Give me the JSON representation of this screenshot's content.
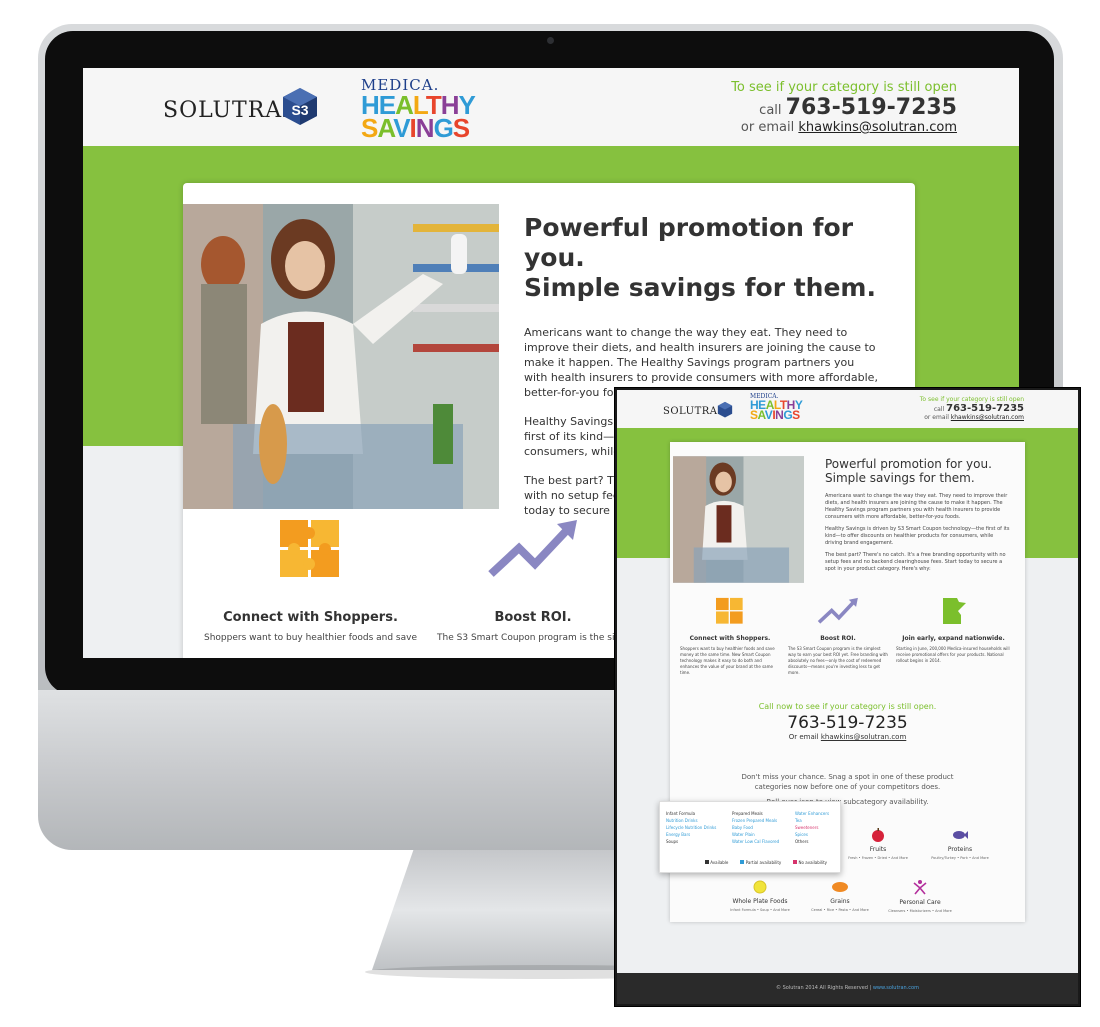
{
  "brand": {
    "solutran": "SOLUTRAN",
    "medica": "MEDICA.",
    "healthy_letters": [
      "H",
      "E",
      "A",
      "L",
      "T",
      "H",
      "Y"
    ],
    "savings_letters": [
      "S",
      "A",
      "V",
      "I",
      "N",
      "G",
      "S"
    ],
    "healthy_colors": [
      "#2f9bd6",
      "#2f9bd6",
      "#7bbf2c",
      "#f3a814",
      "#e8452c",
      "#8a3f97",
      "#2f9bd6"
    ],
    "savings_colors": [
      "#f3a814",
      "#7bbf2c",
      "#2f9bd6",
      "#e8452c",
      "#8a3f97",
      "#2f9bd6",
      "#e8452c"
    ]
  },
  "header": {
    "tagline": "To see if your category is still open",
    "call_prefix": "call",
    "phone": "763-519-7235",
    "email_prefix": "or email",
    "email": "khawkins@solutran.com"
  },
  "hero": {
    "title_line1": "Powerful promotion for you.",
    "title_line2": "Simple savings for them.",
    "para1": "Americans want to change the way they eat. They need to improve their diets, and health insurers are joining the cause to make it happen. The Healthy Savings program partners you with health insurers to provide consumers with more affordable, better-for-you foods.",
    "para2_desktop": "Healthy Savings is driven by S3 Smart Coupon technology—the first of its kind—",
    "para2_desktop_b": "consumers, while",
    "para3_desktop": "The best part? Th",
    "para3_desktop_b": "with no setup fee",
    "para3_desktop_c": "today to secure a",
    "para2": "Healthy Savings is driven by S3 Smart Coupon technology—the first of its kind—to offer discounts on healthier products for consumers, while driving brand engagement.",
    "para3": "The best part? There's no catch. It's a free branding opportunity with no setup fees and no backend clearinghouse fees. Start today to secure a spot in your product category. Here's why:"
  },
  "features": [
    {
      "title": "Connect with Shoppers.",
      "text_desktop": "Shoppers want to buy healthier foods and save",
      "text": "Shoppers want to buy healthier foods and save money at the same time. New Smart Coupon technology makes it easy to do both and enhances the value of your brand at the same time."
    },
    {
      "title": "Boost ROI.",
      "text_desktop": "The S3 Smart Coupon program is the simp",
      "text": "The S3 Smart Coupon program is the simplest way to earn your best ROI yet. Free branding with absolutely no fees—only the cost of redeemed discounts—means you're investing less to get more."
    },
    {
      "title": "Join early, expand nationwide.",
      "text": "Starting in June, 200,000 Medica-insured households will receive promotional offers for your products. National rollout begins in 2014."
    }
  ],
  "cta": {
    "headline": "Call now to see if your category is still open.",
    "phone": "763-519-7235",
    "email_prefix": "Or email",
    "email": "khawkins@solutran.com"
  },
  "categories_intro": {
    "line1": "Don't miss your chance. Snag a spot in one of these product",
    "line2": "categories now before one of your competitors does.",
    "line3": "Roll over icon to view subcategory availability."
  },
  "popup": {
    "col1": [
      "Infant Formula",
      "Nutrition Drinks",
      "Lifecycle Nutrition Drinks",
      "Energy Bars",
      "Soups"
    ],
    "col2": [
      "Prepared Meals",
      "Frozen Prepared Meals",
      "Baby Food",
      "Water Plain",
      "Water Low Cal Flavored"
    ],
    "col3": [
      "Water Enhancers",
      "Tea",
      "Sweeteners",
      "Spices",
      "Others"
    ],
    "legend": [
      "Available",
      "Partial availability",
      "No availability"
    ],
    "legend_colors": [
      "#333333",
      "#2f9bd6",
      "#d6336c"
    ]
  },
  "categories": [
    {
      "name": "Fruits",
      "sub": "Fresh • Frozen • Dried • And More"
    },
    {
      "name": "Proteins",
      "sub": "Poultry/Turkey • Pork • And More"
    },
    {
      "name": "Whole Plate Foods",
      "sub": "Infant Formula • Soup • And More"
    },
    {
      "name": "Grains",
      "sub": "Cereal • Rice • Pasta • And More"
    },
    {
      "name": "Personal Care",
      "sub": "Cleansers • Moisturizers • And More"
    }
  ],
  "footer": {
    "copyright": "© Solutran 2014 All Rights Reserved |",
    "link": "www.solutran.com"
  },
  "colors": {
    "green": "#86c13f",
    "accent_green": "#7bbf2c",
    "link_blue": "#4aa3df"
  }
}
